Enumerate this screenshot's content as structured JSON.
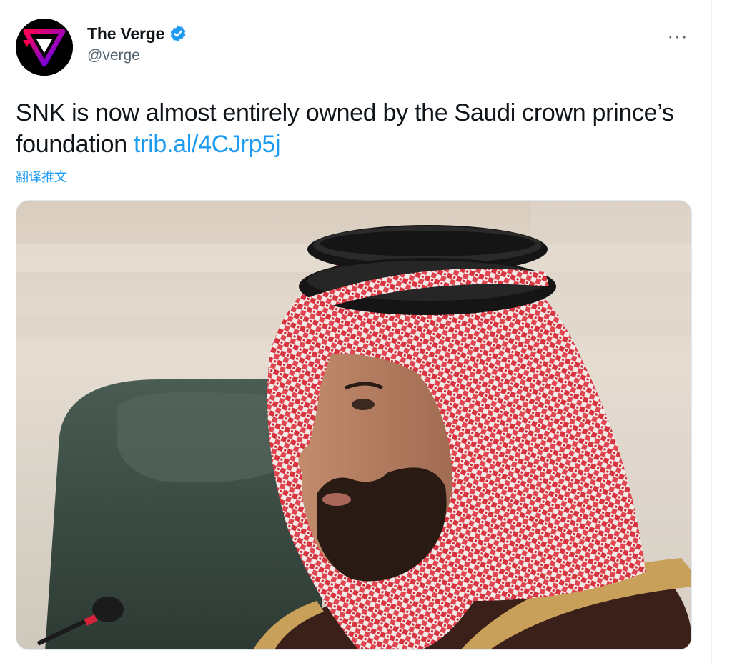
{
  "author": {
    "display_name": "The Verge",
    "handle": "@verge",
    "verified": true,
    "brand_colors": [
      "#ff0051",
      "#5200ff"
    ]
  },
  "menu": {
    "more_label": "···"
  },
  "tweet": {
    "text": "SNK is now almost entirely owned by the Saudi crown prince’s foundation ",
    "link": "trib.al/4CJrp5j",
    "translate_label": "翻译推文"
  },
  "colors": {
    "link": "#1d9bf0",
    "text": "#0f1419",
    "secondary": "#536471"
  },
  "icons": {
    "verified": "verified-badge-icon",
    "more": "more-dots-icon",
    "avatar": "verge-logo-icon"
  }
}
